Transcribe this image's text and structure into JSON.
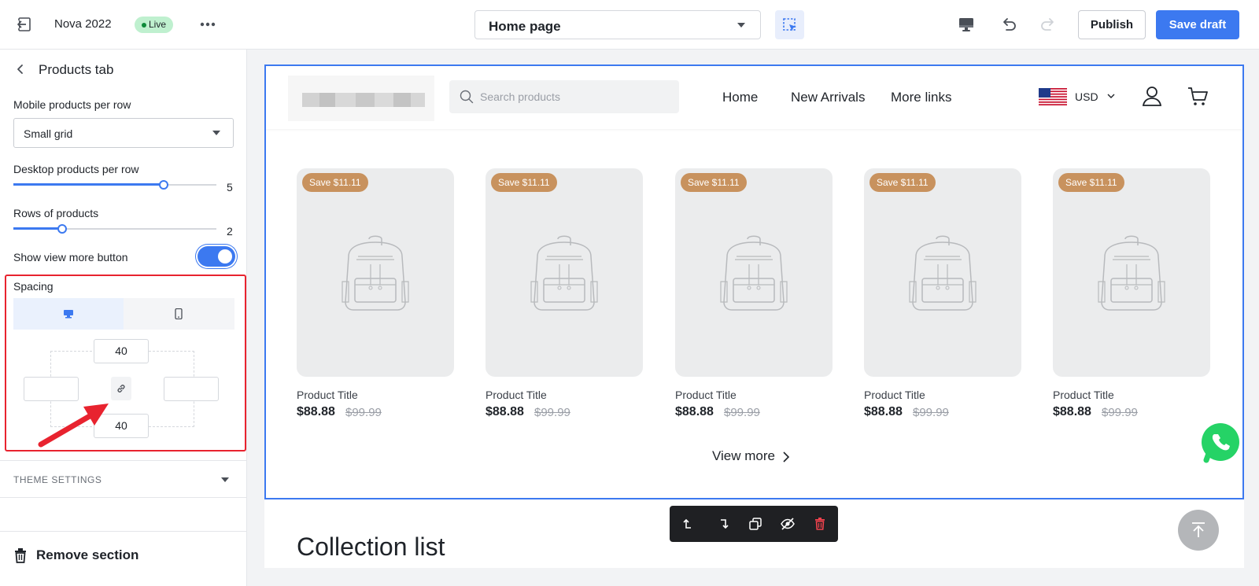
{
  "topbar": {
    "store_name": "Nova 2022",
    "status_badge": "Live",
    "page_select_value": "Home page",
    "publish_label": "Publish",
    "save_draft_label": "Save draft"
  },
  "sidebar": {
    "title": "Products tab",
    "mobile_per_row_label": "Mobile products per row",
    "mobile_per_row_value": "Small grid",
    "desktop_per_row_label": "Desktop products per row",
    "desktop_per_row": {
      "value": "5",
      "fraction": 0.74
    },
    "rows_label": "Rows of products",
    "rows": {
      "value": "2",
      "fraction": 0.24
    },
    "show_view_more_label": "Show view more button",
    "show_view_more_on": true,
    "spacing": {
      "label": "Spacing",
      "top": "40",
      "bottom": "40",
      "left": "",
      "right": ""
    },
    "theme_settings_label": "THEME SETTINGS",
    "remove_section_label": "Remove section"
  },
  "store": {
    "search_placeholder": "Search products",
    "nav": [
      "Home",
      "New Arrivals",
      "More links"
    ],
    "currency": "USD",
    "products": [
      {
        "badge": "Save $11.11",
        "title": "Product Title",
        "price": "$88.88",
        "compare_price": "$99.99"
      },
      {
        "badge": "Save $11.11",
        "title": "Product Title",
        "price": "$88.88",
        "compare_price": "$99.99"
      },
      {
        "badge": "Save $11.11",
        "title": "Product Title",
        "price": "$88.88",
        "compare_price": "$99.99"
      },
      {
        "badge": "Save $11.11",
        "title": "Product Title",
        "price": "$88.88",
        "compare_price": "$99.99"
      },
      {
        "badge": "Save $11.11",
        "title": "Product Title",
        "price": "$88.88",
        "compare_price": "$99.99"
      }
    ],
    "view_more_label": "View more",
    "next_section_title": "Collection list"
  },
  "colors": {
    "accent": "#3c79f0",
    "badge": "#c8925e",
    "highlight": "#e8232f",
    "whatsapp": "#25d366"
  }
}
